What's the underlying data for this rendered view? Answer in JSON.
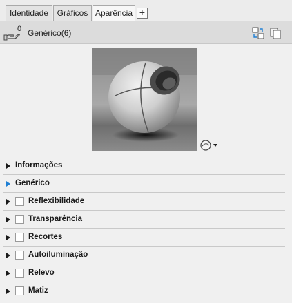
{
  "tabs": [
    {
      "label": "Identidade",
      "active": false
    },
    {
      "label": "Gráficos",
      "active": false
    },
    {
      "label": "Aparência",
      "active": true
    }
  ],
  "add_tab_label": "+",
  "header": {
    "count": "0",
    "title": "Genérico(6)",
    "icons": [
      "hand-holding-icon",
      "swap-material-icon",
      "duplicate-icon"
    ]
  },
  "preview": {
    "icons": [
      "render-preview-icon",
      "chevron-down-icon"
    ]
  },
  "panels": [
    {
      "label": "Informações",
      "checkbox": false,
      "expanded": false
    },
    {
      "label": "Genérico",
      "checkbox": false,
      "expanded": false,
      "accent": "#1e7fd4"
    },
    {
      "label": "Reflexibilidade",
      "checkbox": true,
      "checked": false
    },
    {
      "label": "Transparência",
      "checkbox": true,
      "checked": false
    },
    {
      "label": "Recortes",
      "checkbox": true,
      "checked": false
    },
    {
      "label": "Autoiluminação",
      "checkbox": true,
      "checked": false
    },
    {
      "label": "Relevo",
      "checkbox": true,
      "checked": false
    },
    {
      "label": "Matiz",
      "checkbox": true,
      "checked": false
    }
  ]
}
